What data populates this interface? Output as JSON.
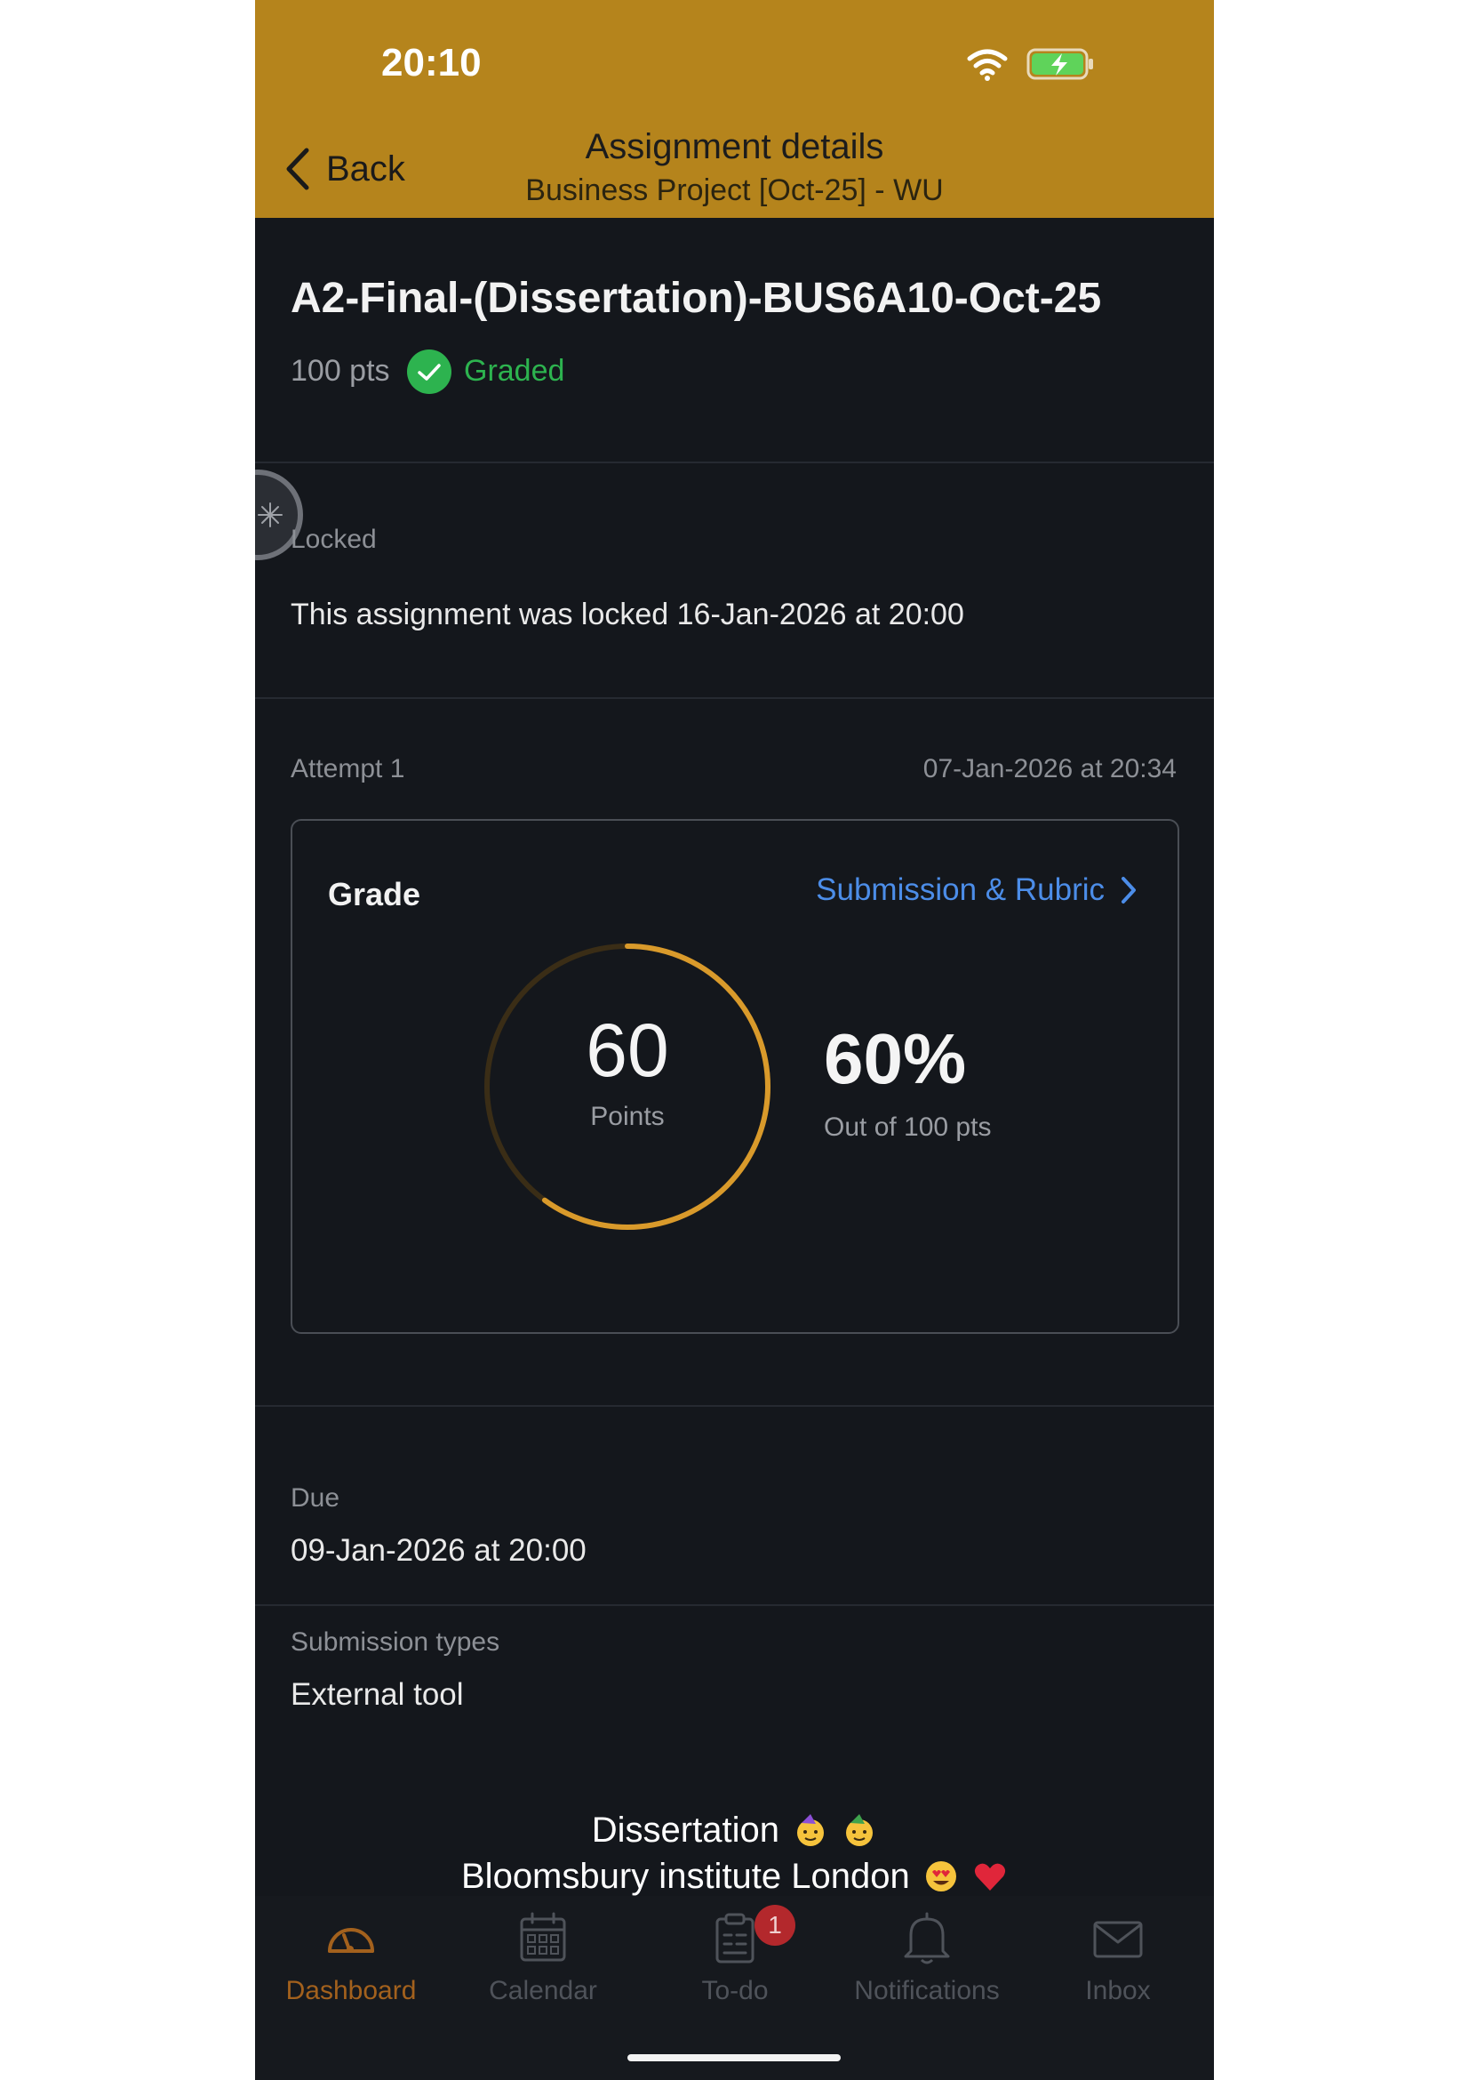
{
  "status_bar": {
    "time": "20:10"
  },
  "header": {
    "back_label": "Back",
    "title": "Assignment details",
    "subtitle": "Business Project [Oct-25] - WU"
  },
  "assignment": {
    "title": "A2-Final-(Dissertation)-BUS6A10-Oct-25",
    "points": "100 pts",
    "status": "Graded"
  },
  "lock": {
    "label": "Locked",
    "text": "This assignment was locked 16-Jan-2026 at 20:00"
  },
  "attempt": {
    "label": "Attempt 1",
    "date": "07-Jan-2026 at 20:34"
  },
  "grade": {
    "label": "Grade",
    "link": "Submission & Rubric",
    "score": "60",
    "score_unit": "Points",
    "score_fraction": 0.6,
    "percent": "60%",
    "out_of": "Out of 100 pts"
  },
  "due": {
    "label": "Due",
    "value": "09-Jan-2026 at 20:00"
  },
  "submission_types": {
    "label": "Submission types",
    "value": "External tool"
  },
  "caption": {
    "line1": "Dissertation",
    "line2": "Bloomsbury institute London"
  },
  "tabs": [
    {
      "label": "Dashboard",
      "icon": "dashboard-gauge-icon",
      "active": true
    },
    {
      "label": "Calendar",
      "icon": "calendar-icon"
    },
    {
      "label": "To-do",
      "icon": "clipboard-icon",
      "badge": "1"
    },
    {
      "label": "Notifications",
      "icon": "bell-icon"
    },
    {
      "label": "Inbox",
      "icon": "envelope-icon"
    }
  ],
  "colors": {
    "header_bg": "#b5841c",
    "accent_ring": "#d99a2b",
    "graded_green": "#2db34f",
    "link_blue": "#4c8de8",
    "active_tab": "#a3611d",
    "badge_red": "#b3282c"
  }
}
